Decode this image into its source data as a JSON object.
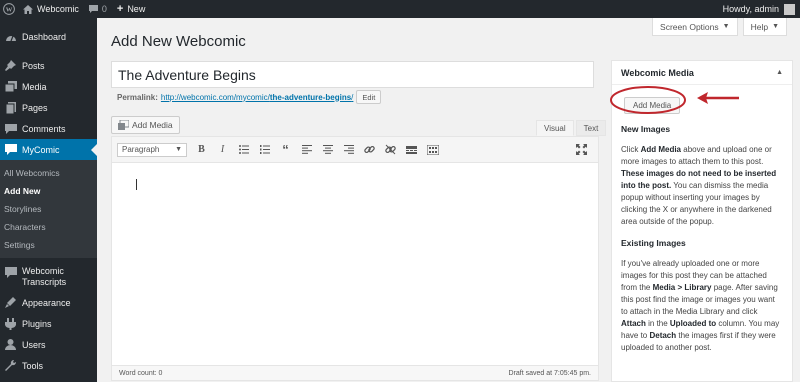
{
  "adminbar": {
    "site_name": "Webcomic",
    "comments_count": "0",
    "new_label": "New",
    "howdy": "Howdy, admin"
  },
  "sidebar": {
    "items_top": [
      {
        "label": "Dashboard",
        "icon": "dashboard-icon"
      },
      {
        "label": "Posts",
        "icon": "pin-icon"
      },
      {
        "label": "Media",
        "icon": "media-icon"
      },
      {
        "label": "Pages",
        "icon": "pages-icon"
      },
      {
        "label": "Comments",
        "icon": "comments-icon"
      },
      {
        "label": "MyComic",
        "icon": "webcomic-icon"
      }
    ],
    "submenu": [
      "All Webcomics",
      "Add New",
      "Storylines",
      "Characters",
      "Settings"
    ],
    "items_bottom": [
      {
        "label": "Webcomic Transcripts",
        "icon": "transcripts-icon"
      },
      {
        "label": "Appearance",
        "icon": "appearance-icon"
      },
      {
        "label": "Plugins",
        "icon": "plugins-icon"
      },
      {
        "label": "Users",
        "icon": "users-icon"
      },
      {
        "label": "Tools",
        "icon": "tools-icon"
      }
    ]
  },
  "header": {
    "title": "Add New Webcomic",
    "screen_options": "Screen Options",
    "help": "Help"
  },
  "post": {
    "title_value": "The Adventure Begins",
    "permalink_label": "Permalink:",
    "permalink_base": "http://webcomic.com/mycomic/",
    "permalink_slug": "the-adventure-begins",
    "permalink_end": "/",
    "edit_label": "Edit"
  },
  "editor": {
    "add_media": "Add Media",
    "tab_visual": "Visual",
    "tab_text": "Text",
    "format": "Paragraph",
    "word_count": "Word count: 0",
    "draft_saved": "Draft saved at 7:05:45 pm."
  },
  "metabox": {
    "title": "Webcomic Media",
    "add_media": "Add Media",
    "new_images_heading": "New Images",
    "p1_a": "Click ",
    "p1_b": "Add Media",
    "p1_c": " above and upload one or more images to attach them to this post. ",
    "p1_d": "These images do not need to be inserted into the post.",
    "p1_e": " You can dismiss the media popup without inserting your images by clicking the X or anywhere in the darkened area outside of the popup.",
    "existing_heading": "Existing Images",
    "p2_a": "If you've already uploaded one or more images for this post they can be attached from the ",
    "p2_b": "Media > Library",
    "p2_c": " page. After saving this post find the image or images you want to attach in the Media Library and click ",
    "p2_d": "Attach",
    "p2_e": " in the ",
    "p2_f": "Uploaded to",
    "p2_g": " column. You may have to ",
    "p2_h": "Detach",
    "p2_i": " the images first if they were uploaded to another post."
  },
  "colors": {
    "admin_dark": "#23282d",
    "accent": "#0073aa",
    "annotation_red": "#c0272d"
  }
}
